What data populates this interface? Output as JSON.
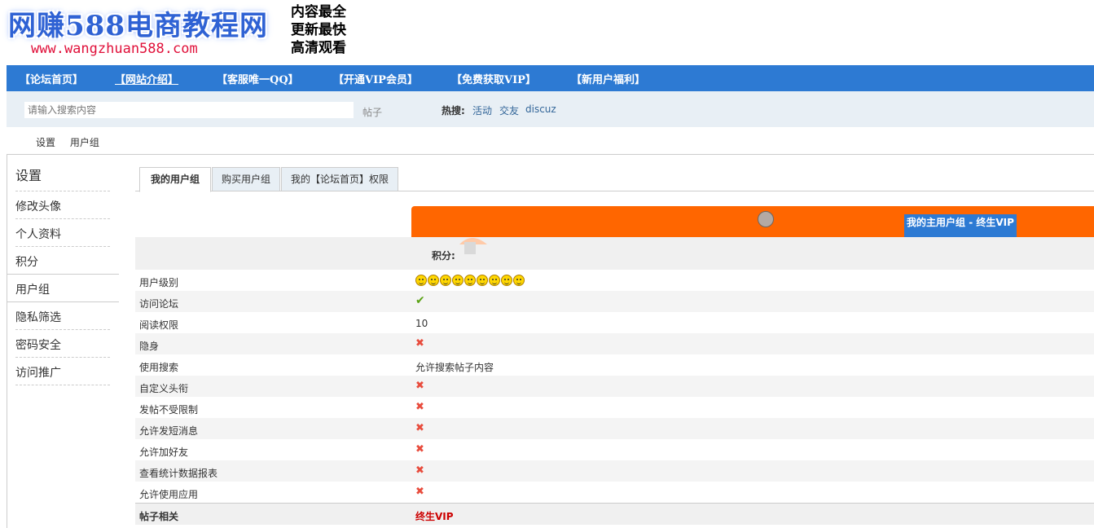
{
  "header": {
    "logo_text": "网赚588电商教程网",
    "logo_url": "www.wangzhuan588.com",
    "slogan": [
      "内容最全",
      "更新最快",
      "高清观看"
    ]
  },
  "nav": [
    "【论坛首页】",
    "【网站介绍】",
    "【客服唯一QQ】",
    "【开通VIP会员】",
    "【免费获取VIP】",
    "【新用户福利】"
  ],
  "search": {
    "placeholder": "请输入搜索内容",
    "type": "帖子",
    "hot_label": "热搜:",
    "hot_links": [
      "活动",
      "交友",
      "discuz"
    ]
  },
  "breadcrumb": [
    "设置",
    "用户组"
  ],
  "sidebar": {
    "title": "设置",
    "items": [
      "修改头像",
      "个人资料",
      "积分",
      "用户组",
      "隐私筛选",
      "密码安全",
      "访问推广"
    ]
  },
  "tabs": [
    "我的用户组",
    "购买用户组",
    "我的【论坛首页】权限"
  ],
  "group": {
    "label": "我的主用户组 - 终生VIP",
    "points_label": "积分:"
  },
  "permissions": [
    {
      "label": "用户级别",
      "type": "stars",
      "count": 9
    },
    {
      "label": "访问论坛",
      "type": "check"
    },
    {
      "label": "阅读权限",
      "type": "text",
      "value": "10"
    },
    {
      "label": "隐身",
      "type": "cross"
    },
    {
      "label": "使用搜索",
      "type": "text",
      "value": "允许搜索帖子内容"
    },
    {
      "label": "自定义头衔",
      "type": "cross"
    },
    {
      "label": "发帖不受限制",
      "type": "cross"
    },
    {
      "label": "允许发短消息",
      "type": "cross"
    },
    {
      "label": "允许加好友",
      "type": "cross"
    },
    {
      "label": "查看统计数据报表",
      "type": "cross"
    },
    {
      "label": "允许使用应用",
      "type": "cross"
    }
  ],
  "section": {
    "label": "帖子相关",
    "value": "终生VIP"
  },
  "icons": {
    "check": "check-icon",
    "cross": "cross-icon",
    "level": "smiley-icon"
  },
  "colors": {
    "nav": "#2d7ad3",
    "orange": "#ff6600",
    "check": "#5aa214",
    "cross": "#e84c3d",
    "vip": "#cc0000"
  }
}
